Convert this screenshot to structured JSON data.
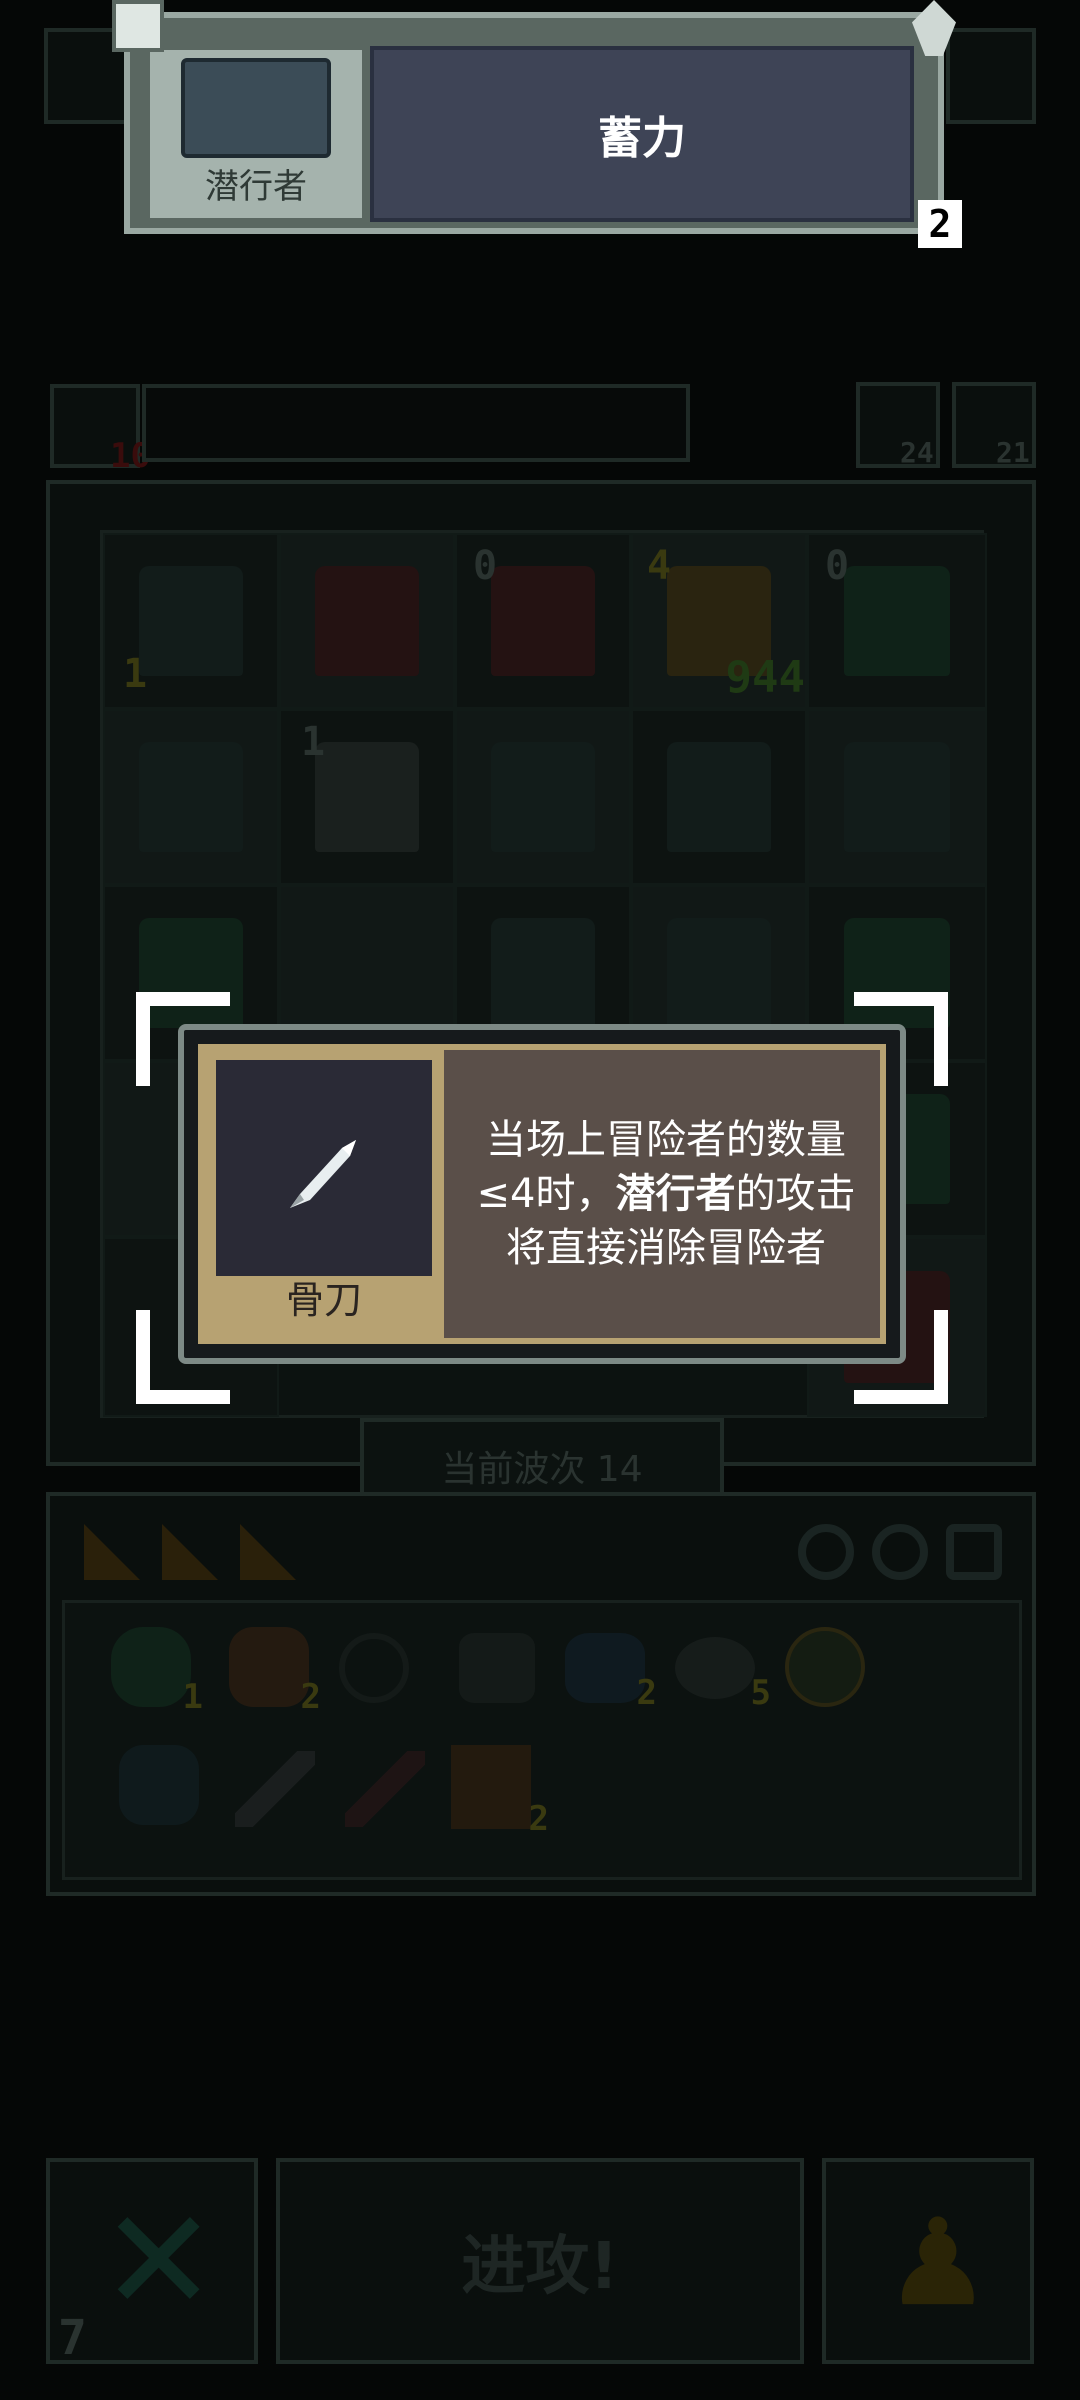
{
  "top_card": {
    "character_name": "潜行者",
    "skill_name": "蓄力",
    "count": "2"
  },
  "item_popup": {
    "item_name": "骨刀",
    "desc_line1": "当场上冒险者的数量",
    "desc_line2_prefix": "≤4时，",
    "desc_line2_bold": "潜行者",
    "desc_line2_suffix": "的攻击",
    "desc_line3": "将直接消除冒险者"
  },
  "status_bar": {
    "health": "10",
    "stat_a": "24",
    "stat_b": "21"
  },
  "board": {
    "row1_counts": [
      "1",
      "",
      "0",
      "4",
      "0"
    ],
    "boss_hp": "944",
    "row2_counts": [
      "",
      "1",
      "",
      "",
      ""
    ]
  },
  "wave": {
    "label": "当前波次 14"
  },
  "inventory": {
    "item_counts": [
      "1",
      "2",
      "",
      "",
      "2",
      "5",
      "",
      "",
      "",
      "",
      "2"
    ]
  },
  "actions": {
    "attack_label": "进攻!",
    "counter": "7"
  },
  "colors": {
    "popup_gold": "#b7a272",
    "popup_brown": "#5a4f49",
    "card_gray": "#5a6761",
    "skill_bg": "#3e4456"
  }
}
